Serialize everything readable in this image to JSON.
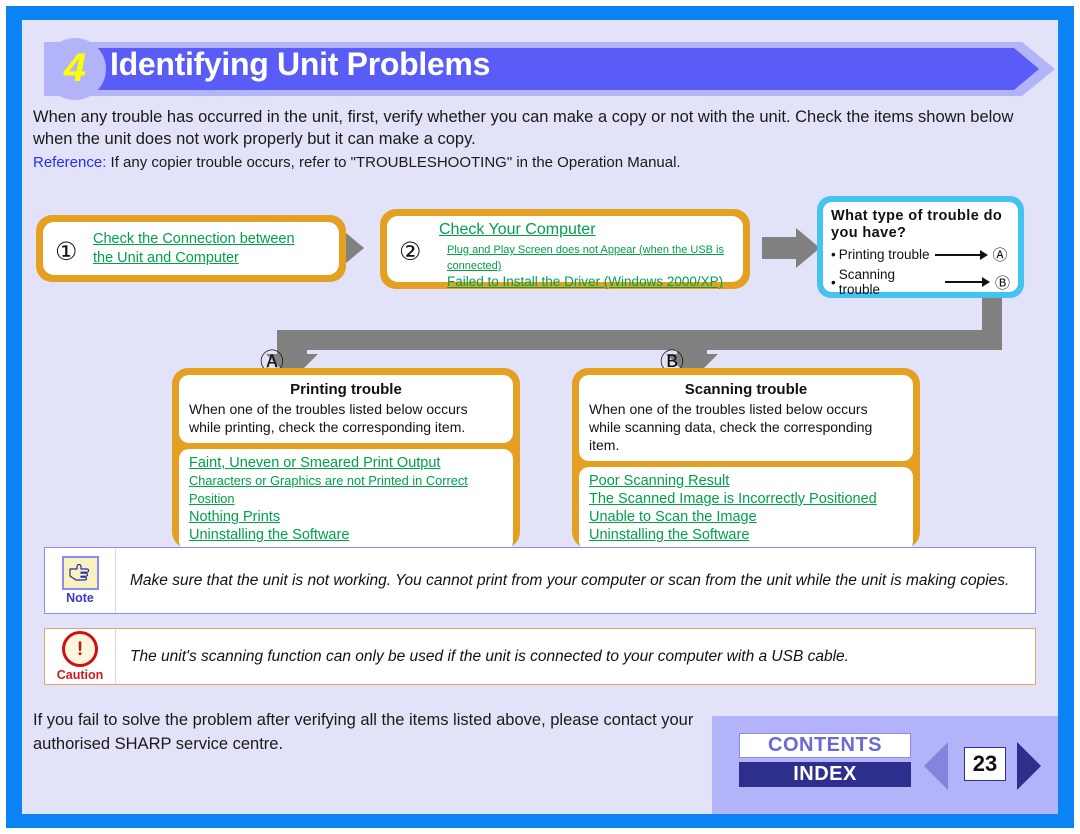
{
  "header": {
    "step_number": "4",
    "title": "Identifying Unit Problems"
  },
  "intro": {
    "paragraph": "When any trouble has occurred in the unit, first, verify whether you can make a copy or not with the unit. Check the items shown below when the unit does not work properly but it can make a copy.",
    "reference_label": "Reference:",
    "reference_text": "If any copier trouble occurs, refer to \"TROUBLESHOOTING\" in the Operation Manual."
  },
  "flow": {
    "step1": {
      "number": "①",
      "links": [
        "Check the Connection between",
        "the Unit and Computer"
      ]
    },
    "step2": {
      "number": "②",
      "title_link": "Check Your Computer",
      "sub_links": [
        "Plug and Play Screen does not Appear (when the USB is connected)",
        "Failed to Install the Driver (Windows 2000/XP)"
      ]
    },
    "trouble_type": {
      "title": "What type of trouble do you have?",
      "options": [
        {
          "bullet": "•",
          "label": "Printing trouble",
          "target": "Ⓐ"
        },
        {
          "bullet": "•",
          "label": "Scanning trouble",
          "target": "Ⓑ"
        }
      ]
    },
    "branch_a_marker": "Ⓐ",
    "branch_b_marker": "Ⓑ"
  },
  "branches": [
    {
      "title": "Printing trouble",
      "description": "When one of the troubles listed below occurs while printing, check the corresponding item.",
      "links": [
        {
          "text": "Faint, Uneven or Smeared Print Output",
          "small": false
        },
        {
          "text": "Characters or Graphics are not Printed in Correct Position",
          "small": true
        },
        {
          "text": "Nothing Prints",
          "small": false
        },
        {
          "text": "Uninstalling the Software",
          "small": false
        }
      ]
    },
    {
      "title": "Scanning trouble",
      "description": "When one of the troubles listed below occurs while scanning data, check the corresponding item.",
      "links": [
        {
          "text": "Poor Scanning Result",
          "small": false
        },
        {
          "text": "The Scanned Image is Incorrectly Positioned",
          "small": false
        },
        {
          "text": "Unable to Scan the Image",
          "small": false
        },
        {
          "text": "Uninstalling the Software",
          "small": false
        }
      ]
    }
  ],
  "note": {
    "label": "Note",
    "icon": "pointing-hand-icon",
    "text": "Make sure that the unit is not working. You cannot print from your computer or scan from the unit while the unit is making copies."
  },
  "caution": {
    "label": "Caution",
    "icon": "exclamation-circle-icon",
    "glyph": "!",
    "text": "The unit's scanning function can only be used if the unit is connected to your computer with a USB cable."
  },
  "footer": {
    "text": "If you fail to solve the problem after verifying all the items listed above, please contact your authorised SHARP service centre.",
    "contents_label": "CONTENTS",
    "index_label": "INDEX",
    "page_number": "23"
  },
  "colors": {
    "frame_blue": "#0a84f5",
    "page_bg": "#e2e2f8",
    "banner_light": "#b3b3fa",
    "banner_dark": "#5a5cf8",
    "step_number_yellow": "#ffff00",
    "orange": "#e3a021",
    "link_green": "#00a14b",
    "cyan": "#45c3f0",
    "arrow_gray": "#808080",
    "nav_dark_purple": "#2e2e8c",
    "caution_red": "#cc1111"
  }
}
